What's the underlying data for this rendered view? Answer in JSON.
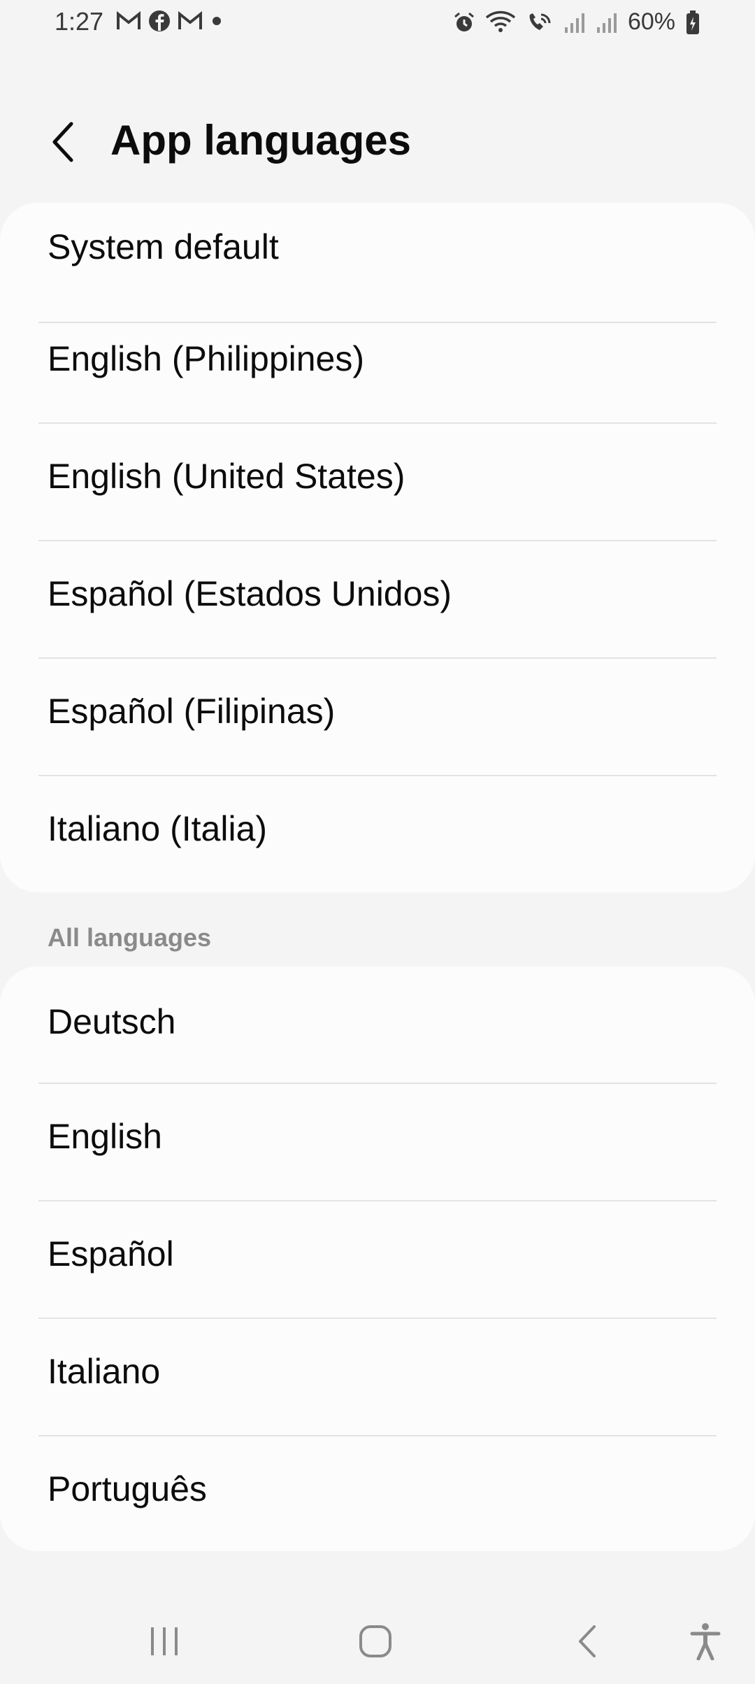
{
  "status_bar": {
    "time": "1:27",
    "left_icons": [
      "gmail-icon",
      "facebook-icon",
      "gmail-icon",
      "dot-icon"
    ],
    "right_icons": [
      "alarm-icon",
      "wifi-icon",
      "wifi-call-icon",
      "signal-icon",
      "signal-icon"
    ],
    "battery": "60%"
  },
  "header": {
    "title": "App languages",
    "back_icon": "chevron-left-icon"
  },
  "suggested_languages": [
    {
      "label": "System default"
    },
    {
      "label": "English (Philippines)"
    },
    {
      "label": "English (United States)"
    },
    {
      "label": "Español (Estados Unidos)"
    },
    {
      "label": "Español (Filipinas)"
    },
    {
      "label": "Italiano (Italia)"
    }
  ],
  "all_languages_header": "All languages",
  "all_languages": [
    {
      "label": "Deutsch"
    },
    {
      "label": "English"
    },
    {
      "label": "Español"
    },
    {
      "label": "Italiano"
    },
    {
      "label": "Português"
    }
  ],
  "nav_bar": {
    "buttons": [
      "recents-icon",
      "home-icon",
      "back-icon",
      "accessibility-icon"
    ]
  }
}
